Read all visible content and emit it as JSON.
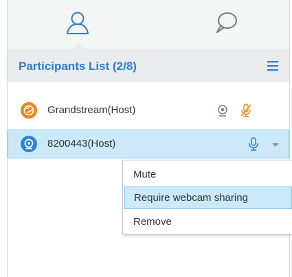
{
  "tabs": [
    {
      "name": "participants",
      "icon": "person-icon",
      "active": true
    },
    {
      "name": "chat",
      "icon": "chat-bubble-icon",
      "active": false
    }
  ],
  "participants_header": {
    "title": "Participants List (2/8)",
    "menu_icon": "hamburger-menu-icon"
  },
  "participants": [
    {
      "name": "Grandstream(Host)",
      "avatar_icon": "globe-avatar-icon",
      "avatar_color": "#f0841e",
      "icons": [
        "webcam-icon",
        "mic-muted-icon"
      ],
      "mic_color": "#f0841e",
      "selected": false
    },
    {
      "name": "8200443(Host)",
      "avatar_icon": "webcam-avatar-icon",
      "avatar_color": "#2b84d4",
      "icons": [
        "mic-icon",
        "chevron-down-icon"
      ],
      "mic_color": "#2b7ccf",
      "selected": true
    }
  ],
  "context_menu": {
    "items": [
      "Mute",
      "Require webcam sharing",
      "Remove"
    ],
    "highlighted": "Require webcam sharing"
  },
  "colors": {
    "accent": "#2b7ccf",
    "header_bg": "#e9ebec",
    "selected_bg": "#cbe9fa",
    "selected_border": "#7cc4ec"
  }
}
